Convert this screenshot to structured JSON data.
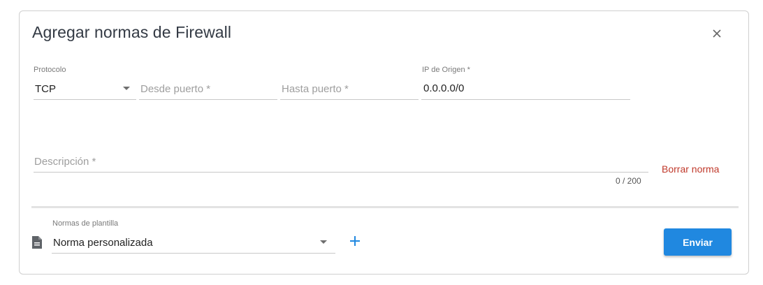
{
  "dialog": {
    "title": "Agregar normas de Firewall",
    "close_icon": "close-icon"
  },
  "rule": {
    "protocol": {
      "label": "Protocolo",
      "value": "TCP"
    },
    "from_port": {
      "placeholder": "Desde puerto *"
    },
    "to_port": {
      "placeholder": "Hasta puerto *"
    },
    "source_ip": {
      "label": "IP de Origen *",
      "value": "0.0.0.0/0"
    },
    "description": {
      "placeholder": "Descripción *",
      "counter": "0 / 200"
    },
    "delete_label": "Borrar norma"
  },
  "template": {
    "label": "Normas de plantilla",
    "value": "Norma personalizada",
    "icon": "document-icon",
    "add_icon": "plus-icon"
  },
  "actions": {
    "submit_label": "Enviar"
  },
  "colors": {
    "accent": "#2088e0",
    "danger": "#c0392b"
  }
}
